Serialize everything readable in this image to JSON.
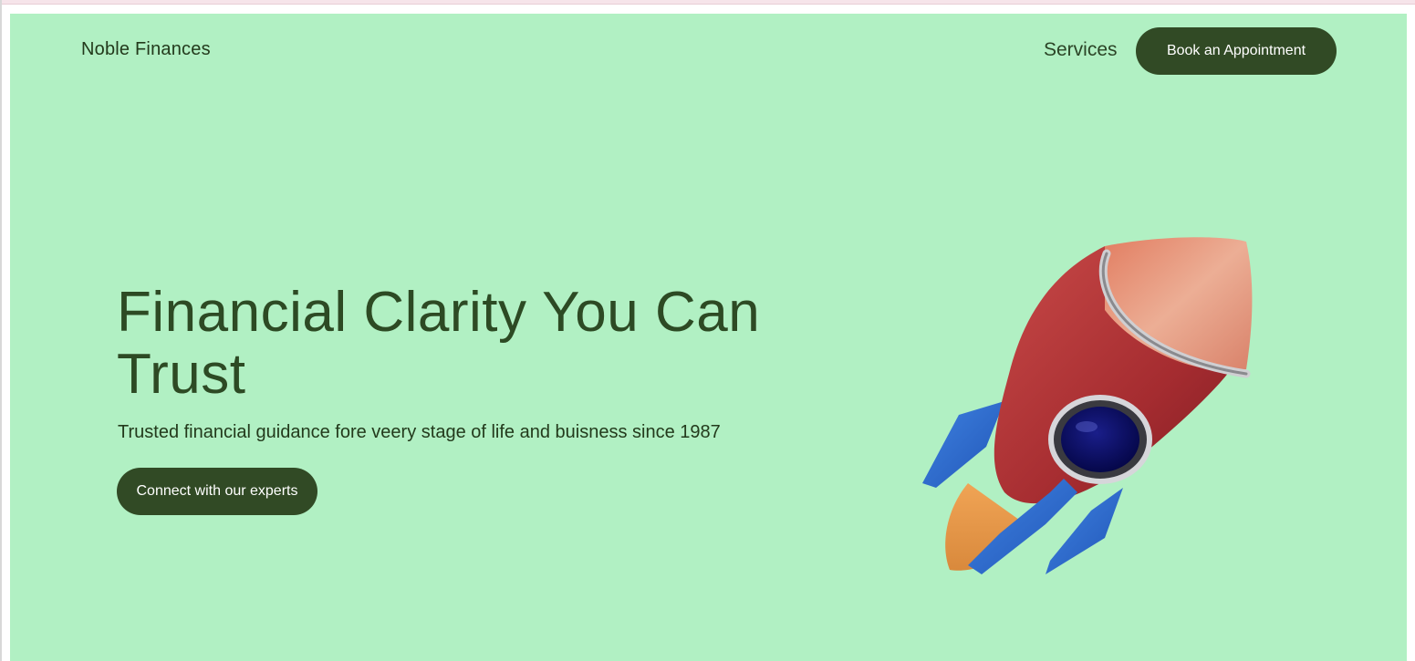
{
  "header": {
    "brand": "Noble Finances",
    "nav_services": "Services",
    "book_button": "Book an Appointment"
  },
  "hero": {
    "headline": "Financial Clarity You Can Trust",
    "subtitle": "Trusted financial guidance fore veery stage of life and buisness since 1987",
    "cta_button": "Connect with our experts",
    "illustration": "rocket"
  },
  "colors": {
    "background": "#b1f0c3",
    "primary_dark": "#314a25",
    "text": "#2d4a24"
  }
}
